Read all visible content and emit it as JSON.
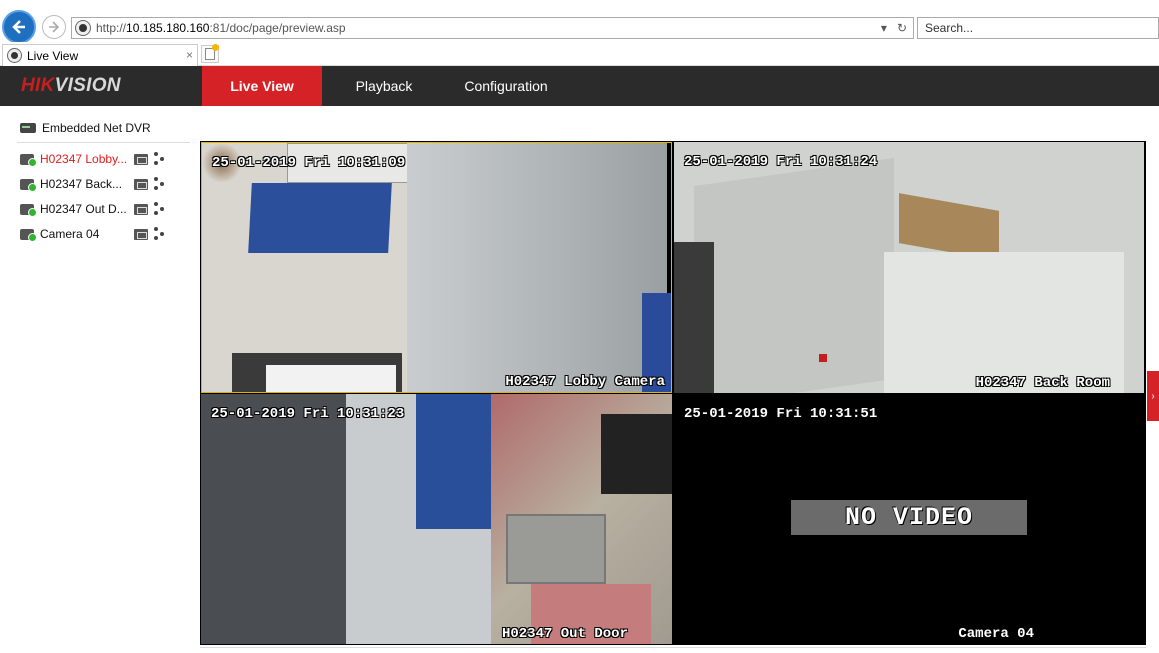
{
  "browser": {
    "url_prefix": "http://",
    "url_host": "10.185.180.160",
    "url_rest": ":81/doc/page/preview.asp",
    "search_placeholder": "Search...",
    "tab_title": "Live View",
    "tab_close": "×"
  },
  "app": {
    "logo_hik": "HIK",
    "logo_vision": "VISION",
    "nav": [
      {
        "label": "Live View",
        "active": true
      },
      {
        "label": "Playback",
        "active": false
      },
      {
        "label": "Configuration",
        "active": false
      }
    ],
    "accent_color": "#d42227"
  },
  "sidebar": {
    "device": "Embedded Net DVR",
    "cameras": [
      {
        "label": "H02347 Lobby...",
        "active": true
      },
      {
        "label": "H02347 Back...",
        "active": false
      },
      {
        "label": "H02347 Out D...",
        "active": false
      },
      {
        "label": "Camera 04",
        "active": false
      }
    ]
  },
  "video": {
    "tiles": [
      {
        "time": "25-01-2019 Fri 10:31:09",
        "name": "H02347 Lobby Camera"
      },
      {
        "time": "25-01-2019 Fri 10:31:24",
        "name": "H02347 Back Room"
      },
      {
        "time": "25-01-2019 Fri 10:31:23",
        "name": "H02347 Out Door"
      },
      {
        "time": "25-01-2019 Fri 10:31:51",
        "name": "Camera 04"
      }
    ],
    "no_video_label": "NO VIDEO"
  }
}
